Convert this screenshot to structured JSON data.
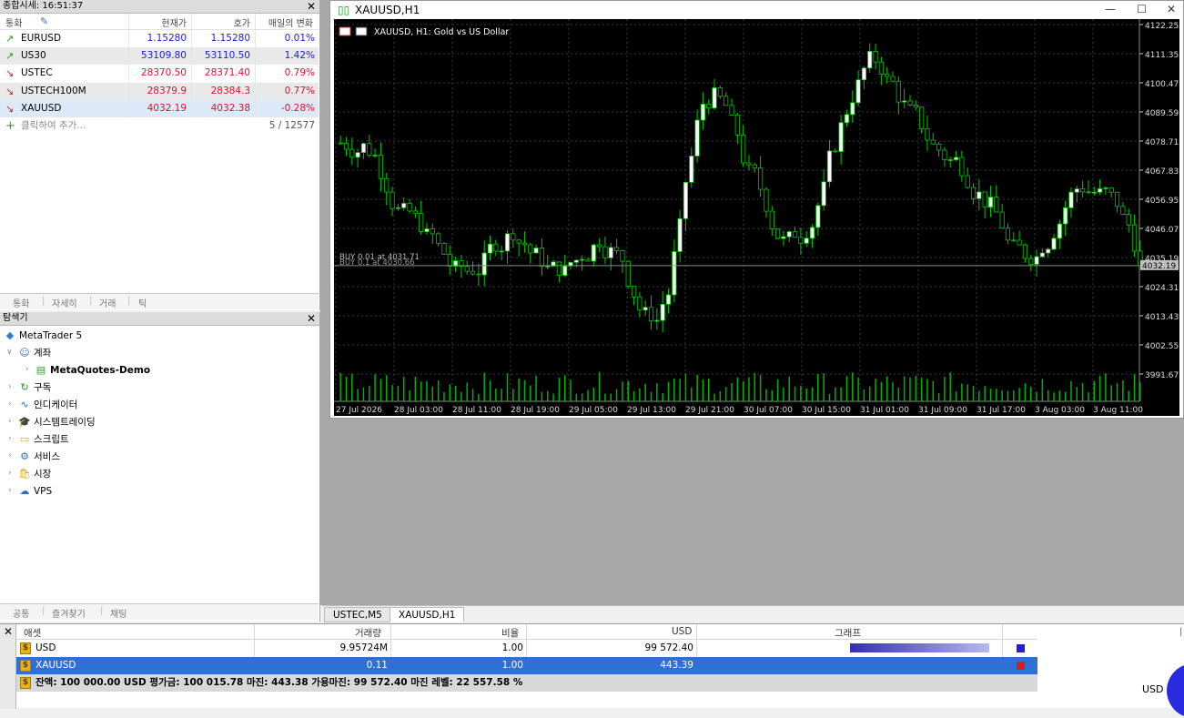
{
  "market_watch": {
    "title": "종합시세: 16:51:37",
    "headers": {
      "symbol": "통화",
      "bid": "현재가",
      "ask": "호가",
      "change": "매일의 변화"
    },
    "rows": [
      {
        "symbol": "EURUSD",
        "bid": "1.15280",
        "ask": "1.15280",
        "change": "0.01%",
        "dir": "up",
        "color": "#1a1adc"
      },
      {
        "symbol": "US30",
        "bid": "53109.80",
        "ask": "53110.50",
        "change": "1.42%",
        "dir": "up",
        "color": "#1a1adc"
      },
      {
        "symbol": "USTEC",
        "bid": "28370.50",
        "ask": "28371.40",
        "change": "0.79%",
        "dir": "down",
        "color": "#e0102a"
      },
      {
        "symbol": "USTECH100M",
        "bid": "28379.9",
        "ask": "28384.3",
        "change": "0.77%",
        "dir": "down",
        "color": "#e0102a"
      },
      {
        "symbol": "XAUUSD",
        "bid": "4032.19",
        "ask": "4032.38",
        "change": "-0.28%",
        "dir": "down",
        "color": "#e0102a"
      }
    ],
    "add_placeholder": "클릭하여 추가...",
    "count": "5 / 12577",
    "tabs": [
      "통화",
      "자세히",
      "거래",
      "틱"
    ]
  },
  "navigator": {
    "title": "탐색기",
    "root": "MetaTrader 5",
    "accounts": "계좌",
    "account_name": "MetaQuotes-Demo",
    "items": [
      "구독",
      "인디케이터",
      "시스템트레이딩",
      "스크립트",
      "서비스",
      "시장",
      "VPS"
    ],
    "tabs": [
      "공통",
      "즐겨찾기",
      "채팅"
    ]
  },
  "chart": {
    "window_title": "XAUUSD,H1",
    "label": "XAUUSD, H1:  Gold vs US Dollar",
    "order_line_1": "BUY 0.01 at 4031.71",
    "order_line_2": "BUY 0.1 at 4030.66",
    "current_price": "4032.19",
    "price_ticks": [
      "4122.25",
      "4111.35",
      "4100.47",
      "4089.59",
      "4078.71",
      "4067.83",
      "4056.95",
      "4046.07",
      "4035.19",
      "4024.31",
      "4013.43",
      "4002.55",
      "3991.67"
    ],
    "time_ticks": [
      "27 Jul 2026",
      "28 Jul 03:00",
      "28 Jul 11:00",
      "28 Jul 19:00",
      "29 Jul 05:00",
      "29 Jul 13:00",
      "29 Jul 21:00",
      "30 Jul 07:00",
      "30 Jul 15:00",
      "31 Jul 01:00",
      "31 Jul 09:00",
      "31 Jul 17:00",
      "3 Aug 03:00",
      "3 Aug 11:00"
    ],
    "bull_color": "#ffffff",
    "bear_color": "#000000",
    "wick_color": "#00c800",
    "volume_color": "#00b400",
    "bid_line_color": "#8a8a8a"
  },
  "chart_tabs": [
    "USTEC,M5",
    "XAUUSD,H1"
  ],
  "exposure": {
    "headers": {
      "asset": "애셋",
      "volume": "거래량",
      "rate": "비율",
      "usd": "USD",
      "graph": "그래프"
    },
    "rows": [
      {
        "asset": "USD",
        "volume": "9.95724M",
        "rate": "1.00",
        "usd": "99 572.40",
        "marker_color": "#2020d0"
      },
      {
        "asset": "XAUUSD",
        "volume": "0.11",
        "rate": "1.00",
        "usd": "443.39",
        "marker_color": "#d02020"
      }
    ],
    "summary": "잔액: 100 000.00 USD  평가금: 100 015.78  마진: 443.38  가용마진: 99 572.40  마진 레벨: 22 557.58 %",
    "pie_label": "USD"
  }
}
